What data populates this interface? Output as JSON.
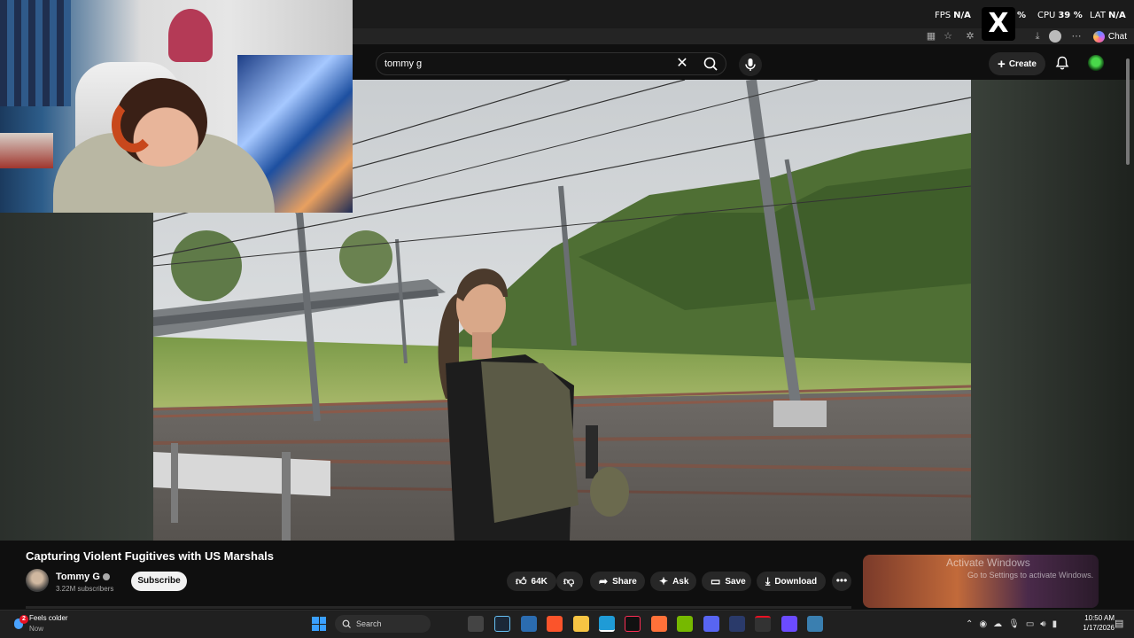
{
  "overlay_stats": {
    "fps_label": "FPS",
    "fps_value": "N/A",
    "gpu_value_partial": "%",
    "cpu_label": "CPU",
    "cpu_value": "39 %",
    "lat_label": "LAT",
    "lat_value": "N/A",
    "x_logo": "X"
  },
  "browser": {
    "chat_label": "Chat"
  },
  "youtube_header": {
    "search_value": "tommy g",
    "clear_glyph": "✕",
    "create_label": "Create"
  },
  "video": {
    "title": "Capturing Violent Fugitives with US Marshals"
  },
  "channel": {
    "name": "Tommy G",
    "subscribers": "3.22M subscribers",
    "subscribe_label": "Subscribe"
  },
  "actions": {
    "like_count": "64K",
    "share_label": "Share",
    "ask_label": "Ask",
    "save_label": "Save",
    "download_label": "Download",
    "more_glyph": "•••"
  },
  "watermark": {
    "line1": "Activate Windows",
    "line2": "Go to Settings to activate Windows."
  },
  "taskbar": {
    "weather_badge": "2",
    "weather_title": "Feels colder",
    "weather_sub": "Now",
    "search_label": "Search",
    "time": "10:50 AM",
    "date": "1/17/2026"
  },
  "colors": {
    "page_bg": "#0f0f0f",
    "pill_bg": "#272727",
    "subscribe_bg": "#f1f1f1",
    "accent_green": "#49d84a"
  }
}
